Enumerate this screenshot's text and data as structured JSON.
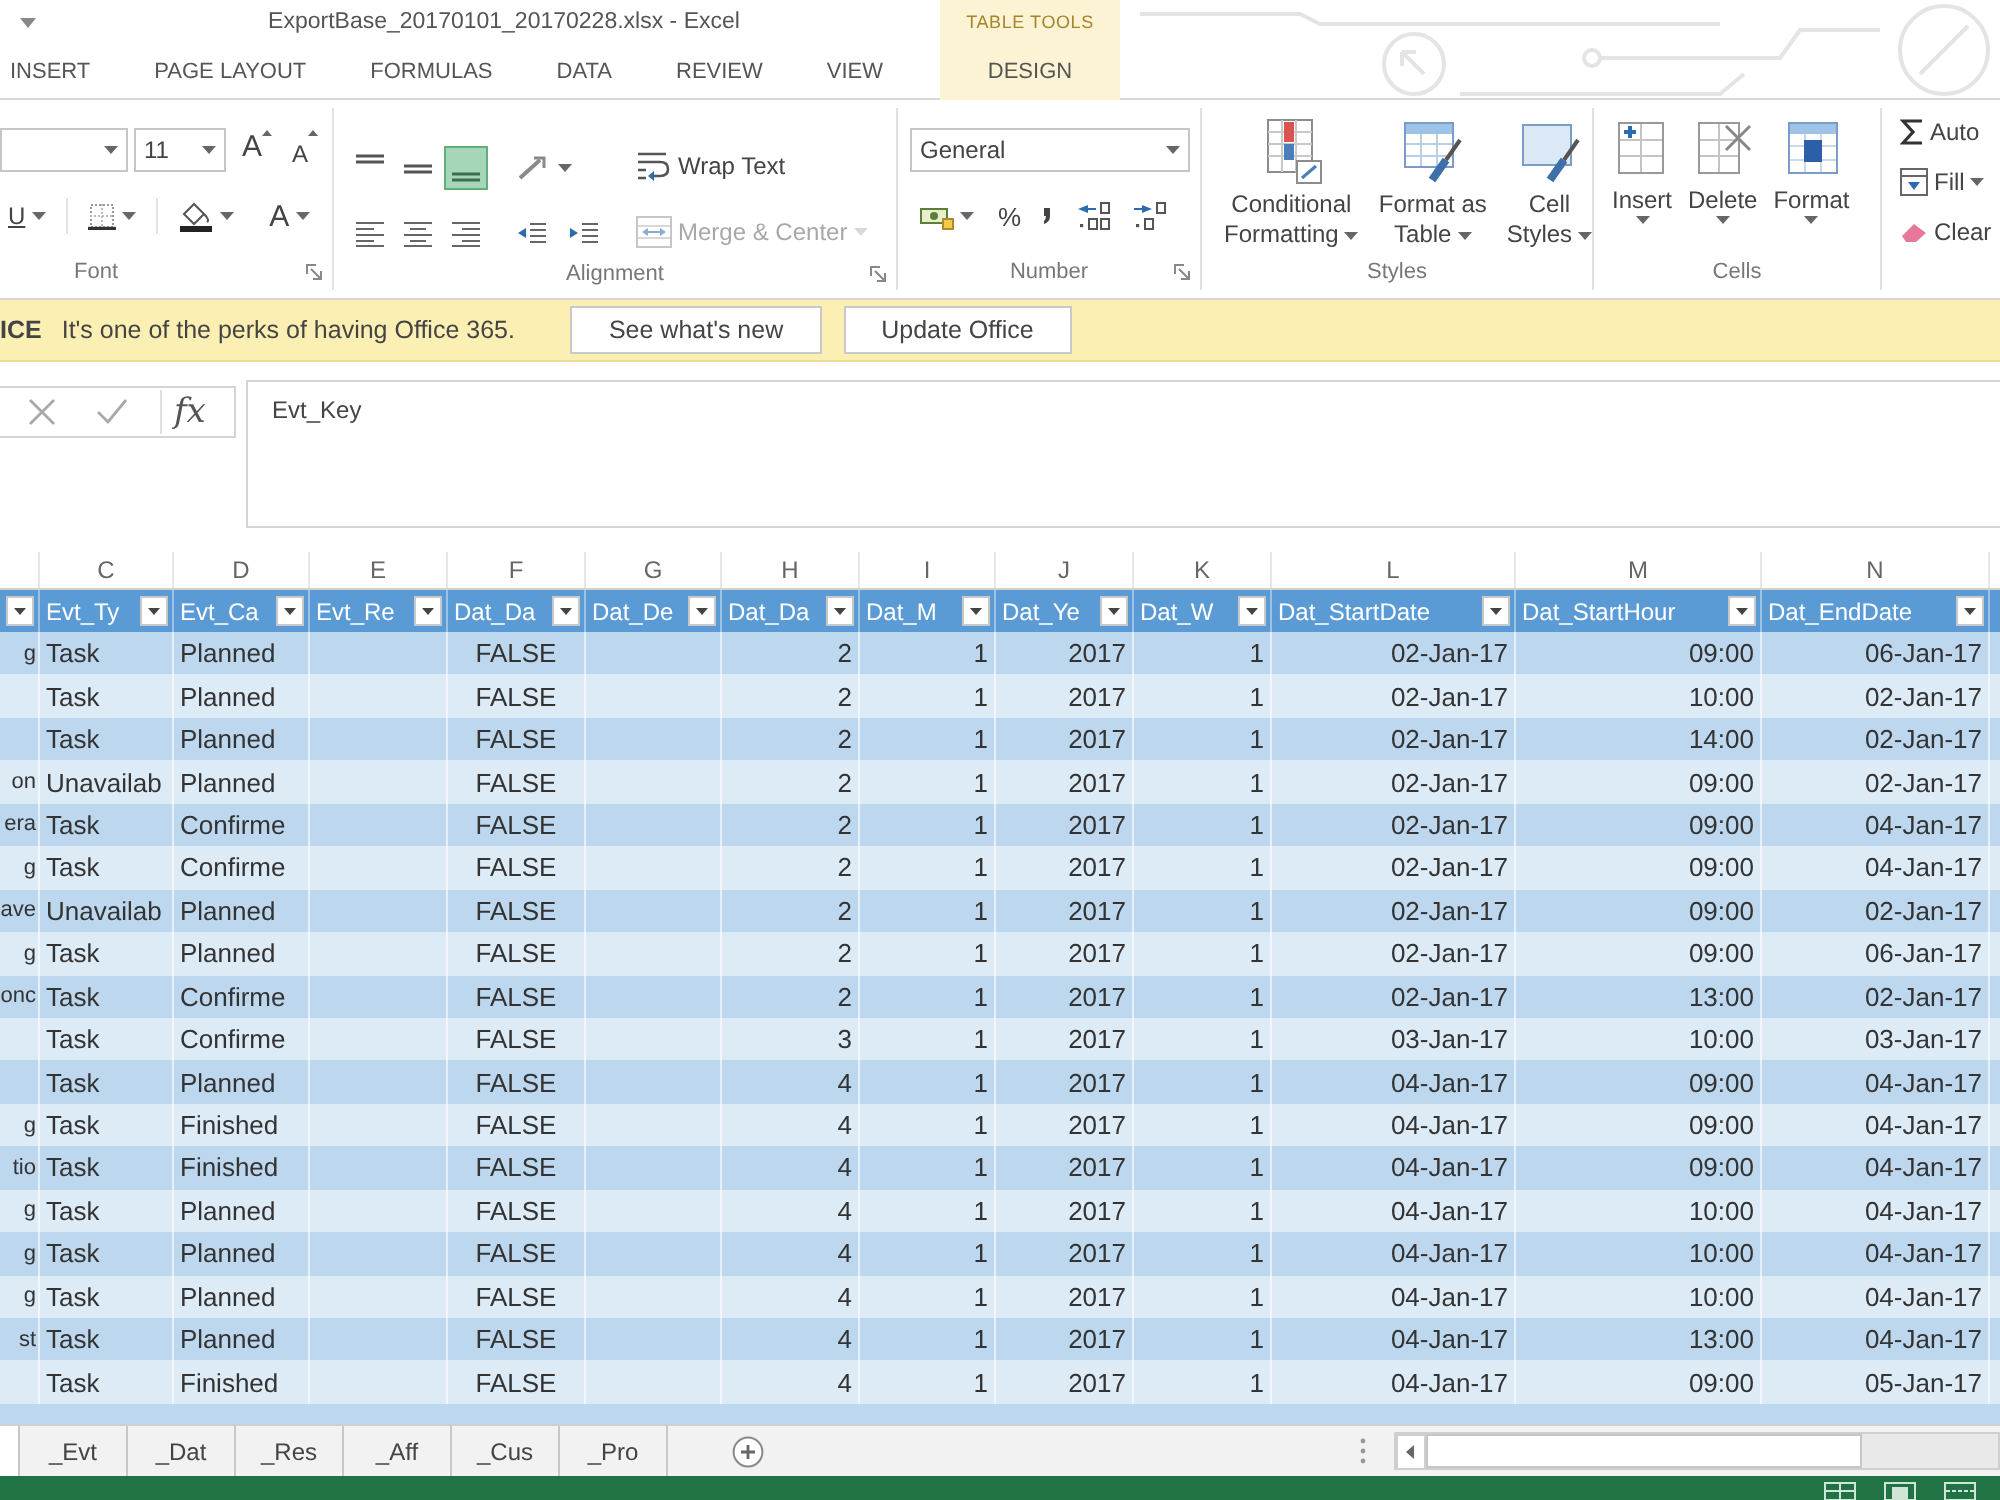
{
  "window": {
    "title": "ExportBase_20170101_20170228.xlsx - Excel",
    "context_label": "TABLE TOOLS"
  },
  "ribbon_tabs": [
    {
      "label": "INSERT",
      "kind": "standard",
      "selected": false
    },
    {
      "label": "PAGE LAYOUT",
      "kind": "standard",
      "selected": false
    },
    {
      "label": "FORMULAS",
      "kind": "standard",
      "selected": false
    },
    {
      "label": "DATA",
      "kind": "standard",
      "selected": false
    },
    {
      "label": "REVIEW",
      "kind": "standard",
      "selected": false
    },
    {
      "label": "VIEW",
      "kind": "standard",
      "selected": false
    },
    {
      "label": "DESIGN",
      "kind": "contextual",
      "selected": false
    }
  ],
  "ribbon": {
    "groups": [
      {
        "kind": "font",
        "label": "Font",
        "launcher": true,
        "font_size": "11",
        "grow_glyph": "A",
        "shrink_glyph": "A",
        "underline_glyph": "U",
        "color_glyph": "A"
      },
      {
        "kind": "alignment",
        "label": "Alignment",
        "launcher": true,
        "vertical": [
          {
            "kind": "top",
            "selected": false
          },
          {
            "kind": "middle",
            "selected": false
          },
          {
            "kind": "bottom",
            "selected": true
          }
        ],
        "horizontal": [
          {
            "kind": "left",
            "selected": false
          },
          {
            "kind": "center",
            "selected": false
          },
          {
            "kind": "right",
            "selected": false
          }
        ],
        "wrap_text": {
          "label": "Wrap Text",
          "disabled": false
        },
        "merge": {
          "label": "Merge & Center",
          "disabled": true
        }
      },
      {
        "kind": "number",
        "label": "Number",
        "launcher": true,
        "format": "General",
        "percent_glyph": "%"
      },
      {
        "kind": "styles",
        "label": "Styles",
        "buttons": [
          {
            "kind": "conditional",
            "lines": [
              "Conditional",
              "Formatting"
            ]
          },
          {
            "kind": "table",
            "lines": [
              "Format as",
              "Table"
            ]
          },
          {
            "kind": "cell",
            "lines": [
              "Cell",
              "Styles"
            ]
          }
        ]
      },
      {
        "kind": "cells",
        "label": "Cells",
        "buttons": [
          {
            "kind": "insert",
            "label": "Insert"
          },
          {
            "kind": "delete",
            "label": "Delete"
          },
          {
            "kind": "format",
            "label": "Format"
          }
        ]
      },
      {
        "kind": "editing",
        "items": [
          {
            "kind": "sum",
            "label": "Auto"
          },
          {
            "kind": "fill",
            "label": "Fill"
          },
          {
            "kind": "clear",
            "label": "Clear"
          }
        ]
      }
    ]
  },
  "notice": {
    "prefix": "ICE",
    "message": "It's one of the perks of having Office 365.",
    "buttons": [
      "See what's new",
      "Update Office"
    ]
  },
  "formula_bar": {
    "function_glyph": "fx",
    "value": "Evt_Key"
  },
  "sheet": {
    "columns": [
      {
        "kind": "cut"
      },
      {
        "kind": "text",
        "letter": "C",
        "title": "Evt_Ty"
      },
      {
        "kind": "text",
        "letter": "D",
        "title": "Evt_Ca"
      },
      {
        "letter": "E",
        "title": "Evt_Re"
      },
      {
        "kind": "bool",
        "letter": "F",
        "title": "Dat_Da"
      },
      {
        "letter": "G",
        "title": "Dat_De"
      },
      {
        "kind": "number",
        "letter": "H",
        "title": "Dat_Da"
      },
      {
        "kind": "number",
        "letter": "I",
        "title": "Dat_M"
      },
      {
        "kind": "number",
        "letter": "J",
        "title": "Dat_Ye"
      },
      {
        "kind": "number",
        "letter": "K",
        "title": "Dat_W"
      },
      {
        "kind": "number",
        "letter": "L",
        "title": "Dat_StartDate"
      },
      {
        "kind": "number",
        "letter": "M",
        "title": "Dat_StartHour"
      },
      {
        "kind": "number",
        "letter": "N",
        "title": "Dat_EndDate"
      }
    ],
    "rows": [
      [
        "g",
        "Task",
        "Planned",
        null,
        "FALSE",
        null,
        "2",
        "1",
        "2017",
        "1",
        "02-Jan-17",
        "09:00",
        "06-Jan-17"
      ],
      [
        null,
        "Task",
        "Planned",
        null,
        "FALSE",
        null,
        "2",
        "1",
        "2017",
        "1",
        "02-Jan-17",
        "10:00",
        "02-Jan-17"
      ],
      [
        null,
        "Task",
        "Planned",
        null,
        "FALSE",
        null,
        "2",
        "1",
        "2017",
        "1",
        "02-Jan-17",
        "14:00",
        "02-Jan-17"
      ],
      [
        "on",
        "Unavailab",
        "Planned",
        null,
        "FALSE",
        null,
        "2",
        "1",
        "2017",
        "1",
        "02-Jan-17",
        "09:00",
        "02-Jan-17"
      ],
      [
        "era",
        "Task",
        "Confirme",
        null,
        "FALSE",
        null,
        "2",
        "1",
        "2017",
        "1",
        "02-Jan-17",
        "09:00",
        "04-Jan-17"
      ],
      [
        "g",
        "Task",
        "Confirme",
        null,
        "FALSE",
        null,
        "2",
        "1",
        "2017",
        "1",
        "02-Jan-17",
        "09:00",
        "04-Jan-17"
      ],
      [
        "ave",
        "Unavailab",
        "Planned",
        null,
        "FALSE",
        null,
        "2",
        "1",
        "2017",
        "1",
        "02-Jan-17",
        "09:00",
        "02-Jan-17"
      ],
      [
        "g",
        "Task",
        "Planned",
        null,
        "FALSE",
        null,
        "2",
        "1",
        "2017",
        "1",
        "02-Jan-17",
        "09:00",
        "06-Jan-17"
      ],
      [
        "onc",
        "Task",
        "Confirme",
        null,
        "FALSE",
        null,
        "2",
        "1",
        "2017",
        "1",
        "02-Jan-17",
        "13:00",
        "02-Jan-17"
      ],
      [
        null,
        "Task",
        "Confirme",
        null,
        "FALSE",
        null,
        "3",
        "1",
        "2017",
        "1",
        "03-Jan-17",
        "10:00",
        "03-Jan-17"
      ],
      [
        null,
        "Task",
        "Planned",
        null,
        "FALSE",
        null,
        "4",
        "1",
        "2017",
        "1",
        "04-Jan-17",
        "09:00",
        "04-Jan-17"
      ],
      [
        "g",
        "Task",
        "Finished",
        null,
        "FALSE",
        null,
        "4",
        "1",
        "2017",
        "1",
        "04-Jan-17",
        "09:00",
        "04-Jan-17"
      ],
      [
        "tio",
        "Task",
        "Finished",
        null,
        "FALSE",
        null,
        "4",
        "1",
        "2017",
        "1",
        "04-Jan-17",
        "09:00",
        "04-Jan-17"
      ],
      [
        "g",
        "Task",
        "Planned",
        null,
        "FALSE",
        null,
        "4",
        "1",
        "2017",
        "1",
        "04-Jan-17",
        "10:00",
        "04-Jan-17"
      ],
      [
        "g",
        "Task",
        "Planned",
        null,
        "FALSE",
        null,
        "4",
        "1",
        "2017",
        "1",
        "04-Jan-17",
        "10:00",
        "04-Jan-17"
      ],
      [
        "g",
        "Task",
        "Planned",
        null,
        "FALSE",
        null,
        "4",
        "1",
        "2017",
        "1",
        "04-Jan-17",
        "10:00",
        "04-Jan-17"
      ],
      [
        "st",
        "Task",
        "Planned",
        null,
        "FALSE",
        null,
        "4",
        "1",
        "2017",
        "1",
        "04-Jan-17",
        "13:00",
        "04-Jan-17"
      ],
      [
        null,
        "Task",
        "Finished",
        null,
        "FALSE",
        null,
        "4",
        "1",
        "2017",
        "1",
        "04-Jan-17",
        "09:00",
        "05-Jan-17"
      ]
    ]
  },
  "sheet_tabs": [
    {
      "selected": true
    },
    {
      "label": "_Evt",
      "selected": false
    },
    {
      "label": "_Dat",
      "selected": false
    },
    {
      "label": "_Res",
      "selected": false
    },
    {
      "label": "_Aff",
      "selected": false
    },
    {
      "label": "_Cus",
      "selected": false
    },
    {
      "label": "_Pro",
      "selected": false
    }
  ]
}
